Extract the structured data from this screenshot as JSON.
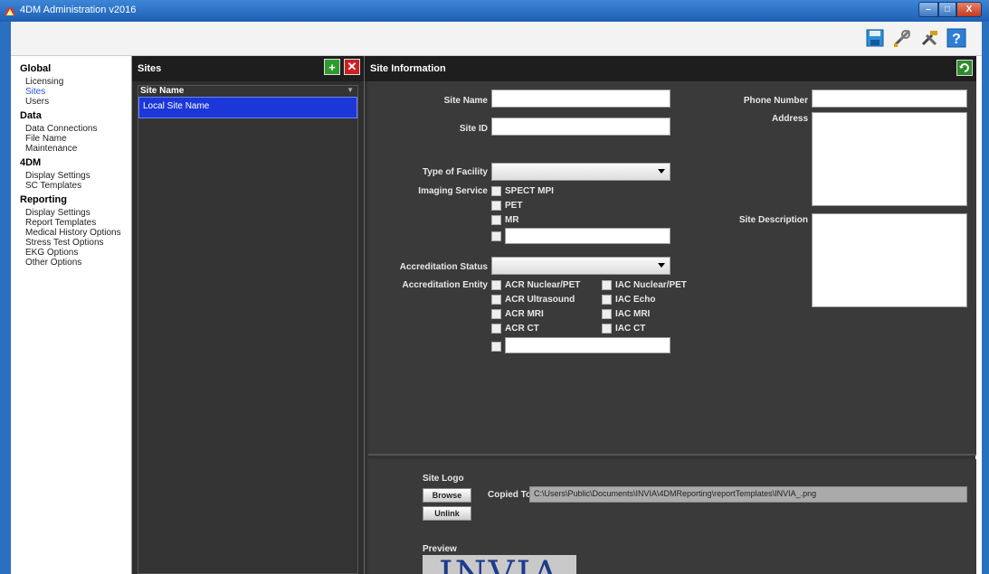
{
  "window": {
    "title": "4DM Administration v2016"
  },
  "nav": {
    "groups": [
      {
        "label": "Global",
        "items": [
          "Licensing",
          "Sites",
          "Users"
        ]
      },
      {
        "label": "Data",
        "items": [
          "Data Connections",
          "File Name",
          "Maintenance"
        ]
      },
      {
        "label": "4DM",
        "items": [
          "Display Settings",
          "SC Templates"
        ]
      },
      {
        "label": "Reporting",
        "items": [
          "Display Settings",
          "Report Templates",
          "Medical History Options",
          "Stress Test Options",
          "EKG Options",
          "Other Options"
        ]
      }
    ]
  },
  "sites": {
    "title": "Sites",
    "column": "Site Name",
    "rows": [
      "Local Site Name"
    ]
  },
  "info": {
    "title": "Site Information",
    "site_name_label": "Site Name",
    "site_name_value": "",
    "site_id_label": "Site ID",
    "site_id_value": "",
    "facility_label": "Type of Facility",
    "facility_value": "",
    "imaging_label": "Imaging Service",
    "imaging_options": [
      "SPECT MPI",
      "PET",
      "MR"
    ],
    "accred_status_label": "Accreditation Status",
    "accred_status_value": "",
    "accred_entity_label": "Accreditation Entity",
    "accred_left": [
      "ACR Nuclear/PET",
      "ACR Ultrasound",
      "ACR MRI",
      "ACR CT"
    ],
    "accred_right": [
      "IAC Nuclear/PET",
      "IAC Echo",
      "IAC MRI",
      "IAC CT"
    ],
    "phone_label": "Phone Number",
    "address_label": "Address",
    "description_label": "Site Description",
    "logo_label": "Site Logo",
    "browse_label": "Browse",
    "unlink_label": "Unlink",
    "copied_to_label": "Copied To",
    "copied_to_value": "C:\\Users\\Public\\Documents\\INVIA\\4DMReporting\\reportTemplates\\INVIA_.png",
    "preview_label": "Preview",
    "logo_text": "INVIA"
  },
  "colors": {
    "accent": "#1c37d8",
    "panel": "#333333",
    "titlebar": "#2b6fc1"
  }
}
